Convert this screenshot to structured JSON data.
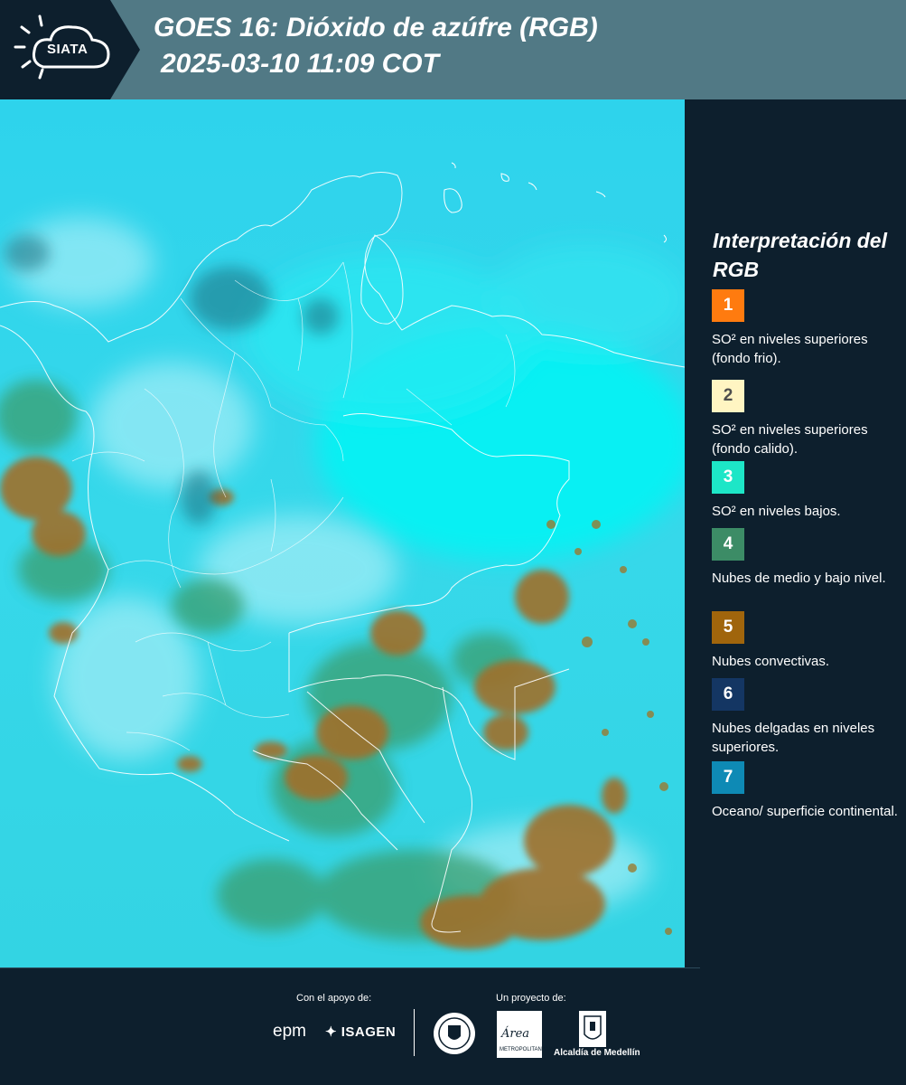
{
  "header": {
    "logo_text": "SIATA",
    "title": "GOES 16: Dióxido de azúfre (RGB)",
    "subtitle": "2025-03-10 11:09 COT",
    "background_color": "#517985"
  },
  "map": {
    "product": "SO2 RGB",
    "region": "Colombia"
  },
  "legend": {
    "title": "Interpretación del RGB",
    "items": [
      {
        "number": "1",
        "color": "#ff7b0f",
        "text_color": "#ffffff",
        "label": "SO² en niveles superiores (fondo frio)."
      },
      {
        "number": "2",
        "color": "#fff5c2",
        "text_color": "#4d4d4d",
        "label": "SO² en niveles superiores (fondo calido)."
      },
      {
        "number": "3",
        "color": "#1de6c7",
        "text_color": "#ffffff",
        "label": "SO² en niveles bajos."
      },
      {
        "number": "4",
        "color": "#3c8c66",
        "text_color": "#ffffff",
        "label": "Nubes de medio y bajo nivel."
      },
      {
        "number": "5",
        "color": "#a0650c",
        "text_color": "#ffffff",
        "label": "Nubes convectivas."
      },
      {
        "number": "6",
        "color": "#143663",
        "text_color": "#ffffff",
        "label": "Nubes delgadas en niveles superiores."
      },
      {
        "number": "7",
        "color": "#0e8ab5",
        "text_color": "#ffffff",
        "label": "Oceano/ superficie continental."
      }
    ]
  },
  "footer": {
    "support_caption": "Con el apoyo de:",
    "project_caption": "Un proyecto de:",
    "sponsor_1": "epm",
    "sponsor_2": "ISAGEN",
    "area_logo_text": "Área",
    "area_logo_subtext": "METROPOLITANA Valle de Aburrá",
    "alcaldia": "Alcaldía de Medellín"
  }
}
